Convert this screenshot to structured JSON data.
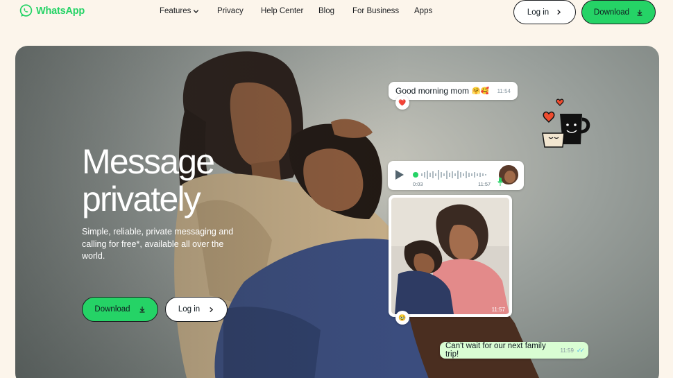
{
  "brand": {
    "name": "WhatsApp",
    "color": "#25d366"
  },
  "nav": {
    "links": [
      {
        "label": "Features",
        "icon": "chevron-down-icon"
      },
      {
        "label": "Privacy"
      },
      {
        "label": "Help Center"
      },
      {
        "label": "Blog"
      },
      {
        "label": "For Business"
      },
      {
        "label": "Apps"
      }
    ],
    "login_label": "Log in",
    "download_label": "Download"
  },
  "hero": {
    "headline_line1": "Message",
    "headline_line2": "privately",
    "subtext": "Simple, reliable, private messaging and calling for free*, available all over the world.",
    "download_label": "Download",
    "login_label": "Log in"
  },
  "chat": {
    "message1": {
      "text": "Good morning mom",
      "emoji": "🤗🥰",
      "time": "11:54",
      "reaction": "❤️"
    },
    "voice": {
      "elapsed": "0:03",
      "time": "11:57"
    },
    "photo": {
      "time": "11:57",
      "reaction": "🥹"
    },
    "message2": {
      "text": "Can't wait for our next family trip!",
      "time": "11:59"
    }
  },
  "colors": {
    "page_bg": "#fcf5eb",
    "accent": "#25d366",
    "sent_bubble": "#d9fdd3",
    "read_ticks": "#53bdeb"
  }
}
